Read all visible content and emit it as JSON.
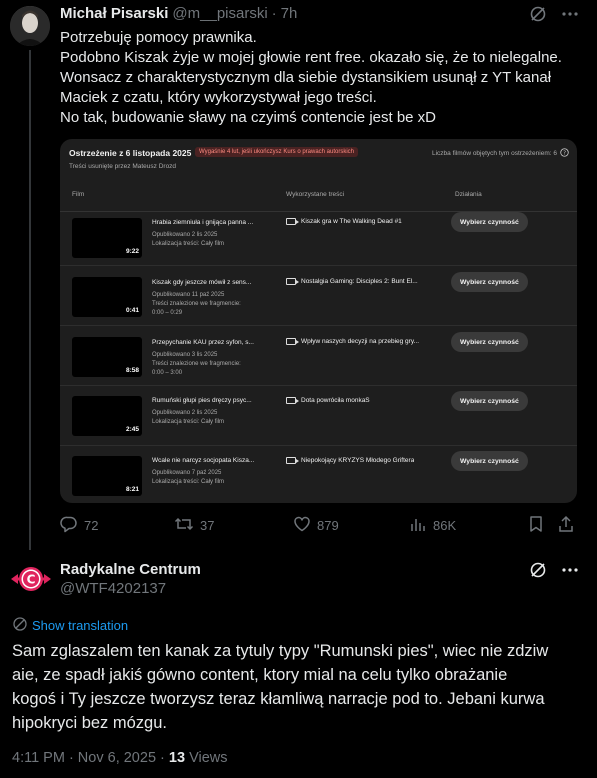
{
  "post1": {
    "author_name": "Michał Pisarski",
    "handle": "@m__pisarski",
    "separator": "·",
    "time": "7h",
    "lines": [
      "Potrzebuję pomocy prawnika.",
      "Podobno Kiszak żyje w mojej głowie rent free. okazało się, że to nielegalne.",
      "Wonsacz z charakterystycznym dla siebie dystansikiem usunął z YT kanał",
      "Maciek z czatu, który wykorzystywał jego treści.",
      "No tak, budowanie sławy na czyimś contencie jest be xD"
    ],
    "card": {
      "title": "Ostrzeżenie z 6 listopada 2025",
      "badge": "Wygaśnie 4 lut, jeśli ukończysz Kurs o prawach autorskich",
      "subtitle": "Treści usunięte przez Mateusz Drozd",
      "count_label": "Liczba filmów objętych tym ostrzeżeniem: 6",
      "columns": {
        "film": "Film",
        "content": "Wykorzystane treści",
        "actions": "Działania"
      },
      "rows": [
        {
          "duration": "9:22",
          "title": "Hrabia ziemniuła i gnijąca panna ...",
          "meta1": "Opublikowano 2 lis 2025",
          "meta2": "Lokalizacja treści: Cały film",
          "meta3": "",
          "content": "Kiszak gra w The Walking Dead #1",
          "action": "Wybierz czynność"
        },
        {
          "duration": "0:41",
          "title": "Kiszak gdy jeszcze mówił z sens...",
          "meta1": "Opublikowano 11 paź 2025",
          "meta2": "Treści znalezione we fragmencie:",
          "meta3": "0:00 – 0:29",
          "content": "Nostalgia Gaming: Disciples 2: Bunt El...",
          "action": "Wybierz czynność"
        },
        {
          "duration": "8:58",
          "title": "Przepychanie KAU przez syfon, s...",
          "meta1": "Opublikowano 3 lis 2025",
          "meta2": "Treści znalezione we fragmencie:",
          "meta3": "0:00 – 3:00",
          "content": "Wpływ naszych decyzji na przebieg gry...",
          "action": "Wybierz czynność"
        },
        {
          "duration": "2:45",
          "title": "Rumuński głupi pies dręczy psyc...",
          "meta1": "Opublikowano 2 lis 2025",
          "meta2": "Lokalizacja treści: Cały film",
          "meta3": "",
          "content": "Dota powróciła monkaS",
          "action": "Wybierz czynność"
        },
        {
          "duration": "8:21",
          "title": "Wcale nie narcyz socjopata Kisza...",
          "meta1": "Opublikowano 7 paź 2025",
          "meta2": "Lokalizacja treści: Cały film",
          "meta3": "",
          "content": "Niepokojący KRYZYS Młodego Griftera",
          "action": "Wybierz czynność"
        }
      ]
    },
    "stats": {
      "replies": "72",
      "reposts": "37",
      "likes": "879",
      "views": "86K"
    }
  },
  "post2": {
    "author_name": "Radykalne Centrum",
    "handle": "@WTF4202137",
    "avatar_letter": "C",
    "show_translation": "Show translation",
    "lines": [
      "Sam zglaszalem ten kanak za tytuly typy \"Rumunski pies\", wiec nie zdziw",
      "aie, ze spadł jakiś gówno content, ktory mial na celu tylko obrażanie",
      "kogoś i Ty jeszcze tworzysz teraz kłamliwą narracje pod to. Jebani kurwa",
      "hipokryci bez mózgu."
    ],
    "timestamp": "4:11 PM · Nov 6, 2025 ·",
    "views_count": "13",
    "views_label": "Views"
  },
  "colors": {
    "accent": "#1d9bf0",
    "muted": "#71767b",
    "text": "#e7e9ea",
    "badge_red": "#ff8a80",
    "avatar_red": "#e0245e"
  },
  "icons": [
    "grok-icon",
    "more-icon",
    "reply-icon",
    "repost-icon",
    "like-icon",
    "views-icon",
    "bookmark-icon",
    "share-icon",
    "help-icon",
    "video-icon",
    "translate-icon"
  ]
}
